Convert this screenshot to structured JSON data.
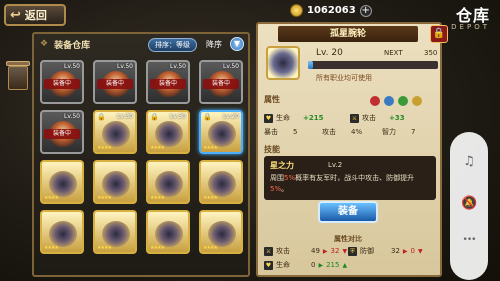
{
  "header": {
    "back_label": "返回",
    "gold_amount": "1062063",
    "plus_glyph": "+",
    "title_cn": "仓库",
    "title_en": "DEPOT"
  },
  "warehouse": {
    "title": "装备仓库",
    "sort_label": "排序：等级",
    "order_label": "降序",
    "order_glyph": "▼",
    "slots": [
      {
        "type": "gray",
        "lv": "Lv.50",
        "equipped": "装备中"
      },
      {
        "type": "gray",
        "lv": "Lv.50",
        "equipped": "装备中"
      },
      {
        "type": "gray",
        "lv": "Lv.50",
        "equipped": "装备中"
      },
      {
        "type": "gray",
        "lv": "Lv.50",
        "equipped": "装备中"
      },
      {
        "type": "gray",
        "lv": "Lv.50",
        "equipped": "装备中"
      },
      {
        "type": "gold",
        "lv": "Lv.30",
        "equipped": "",
        "lock": "🔒"
      },
      {
        "type": "gold",
        "lv": "Lv.30",
        "equipped": "",
        "lock": "🔒"
      },
      {
        "type": "gold",
        "lv": "Lv.20",
        "equipped": "",
        "lock": "🔒",
        "selected": true
      },
      {
        "type": "gold",
        "lv": "",
        "equipped": ""
      },
      {
        "type": "gold",
        "lv": "",
        "equipped": ""
      },
      {
        "type": "gold",
        "lv": "",
        "equipped": ""
      },
      {
        "type": "gold",
        "lv": "",
        "equipped": ""
      },
      {
        "type": "gold",
        "lv": "",
        "equipped": ""
      },
      {
        "type": "gold",
        "lv": "",
        "equipped": ""
      },
      {
        "type": "gold",
        "lv": "",
        "equipped": ""
      },
      {
        "type": "gold",
        "lv": "",
        "equipped": ""
      }
    ],
    "star_glyphs": "★★★★"
  },
  "detail": {
    "item_name": "孤星腕轮",
    "lock_glyph": "🔒",
    "level": "Lv. 20",
    "next_label": "NEXT",
    "exp_value": "350",
    "exp_fraction": 0.04,
    "equip_note": "所有职业均可使用",
    "attr_header": "属性",
    "attrs": {
      "hp_label": "生命",
      "hp_value": "+215",
      "atk_label": "攻击",
      "atk_value": "+33",
      "crit_label": "暴击",
      "crit_value": "5",
      "atk2_label": "攻击",
      "atk2_value": "4%",
      "def_label": "智力",
      "def_value": "7"
    },
    "skill_header": "技能",
    "skill_name": "星之力",
    "skill_level": "Lv.2",
    "skill_desc_1": "周围",
    "skill_desc_pct1": "5%",
    "skill_desc_2": "概率有友军时，战斗中攻击、防御提",
    "skill_desc_3": "升",
    "skill_desc_pct2": "5%",
    "skill_desc_end": "。",
    "equip_button": "装备",
    "compare_header": "属性对比",
    "compare": {
      "atk_label": "攻击",
      "atk_from": "49",
      "atk_to": "32",
      "def_label": "防御",
      "def_from": "32",
      "def_to": "0",
      "hp_label": "生命",
      "hp_from": "0",
      "hp_to": "215"
    }
  },
  "side": {
    "music_glyph": "♫",
    "bell_glyph": "🔕",
    "more_glyph": "•••"
  },
  "colors": {
    "gold_border": "#d8b040",
    "selected_border": "#4ab0ff",
    "equip_button": "#1a5aa8",
    "equipped_badge": "#8a1010"
  }
}
